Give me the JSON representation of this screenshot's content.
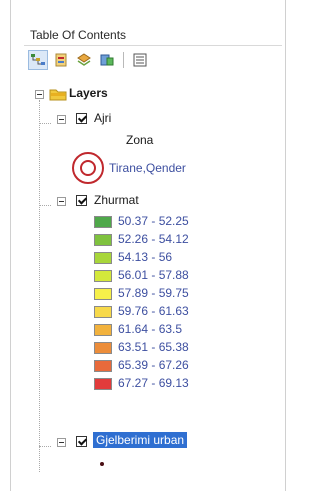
{
  "panel": {
    "title": "Table Of Contents"
  },
  "toolbar": {
    "buttons": [
      {
        "icon": "list-by-drawing-order-icon"
      },
      {
        "icon": "list-by-source-icon"
      },
      {
        "icon": "list-by-visibility-icon"
      },
      {
        "icon": "list-by-selection-icon"
      },
      {
        "icon": "options-icon"
      }
    ]
  },
  "tree": {
    "root_label": "Layers",
    "layers": [
      {
        "name": "Ajri",
        "checked": true,
        "field_label": "Zona",
        "symbol_label": "Tirane,Qender",
        "symbol_color": "#c0282d"
      },
      {
        "name": "Zhurmat",
        "checked": true,
        "classes": [
          {
            "label": "50.37 - 52.25",
            "color": "#4fa84a"
          },
          {
            "label": "52.26 - 54.12",
            "color": "#7fc23e"
          },
          {
            "label": "54.13 - 56",
            "color": "#a8d63a"
          },
          {
            "label": "56.01 - 57.88",
            "color": "#d3e83b"
          },
          {
            "label": "57.89 - 59.75",
            "color": "#f6f04a"
          },
          {
            "label": "59.76 - 61.63",
            "color": "#f7d94a"
          },
          {
            "label": "61.64 - 63.5",
            "color": "#f2b23d"
          },
          {
            "label": "63.51 - 65.38",
            "color": "#ec8d3a"
          },
          {
            "label": "65.39 - 67.26",
            "color": "#e86a3b"
          },
          {
            "label": "67.27 - 69.13",
            "color": "#e23b3b"
          }
        ]
      },
      {
        "name": "Gjelberimi urban",
        "checked": true,
        "selected": true,
        "symbol_color": "#4a0f14"
      }
    ]
  }
}
